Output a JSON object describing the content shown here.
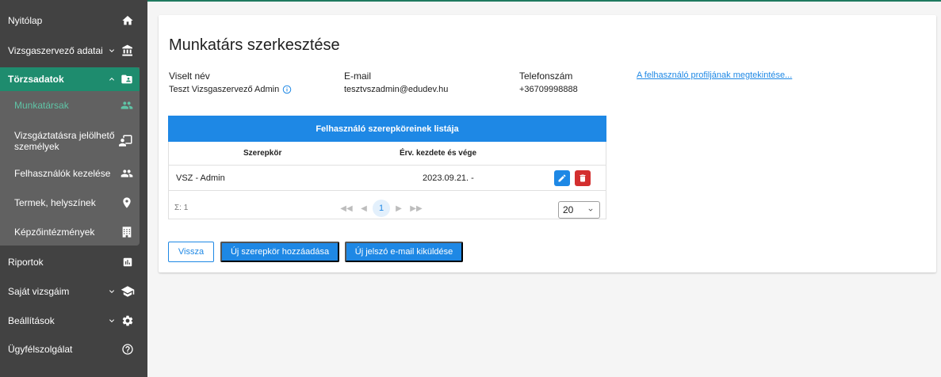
{
  "sidebar": {
    "items": [
      {
        "label": "Nyitólap"
      },
      {
        "label": "Vizsgaszervező adatai"
      },
      {
        "label": "Törzsadatok"
      },
      {
        "label": "Riportok"
      },
      {
        "label": "Saját vizsgáim"
      },
      {
        "label": "Beállítások"
      },
      {
        "label": "Ügyfélszolgálat"
      }
    ],
    "submenu": [
      {
        "label": "Munkatársak"
      },
      {
        "label": "Vizsgáztatásra jelölhető személyek"
      },
      {
        "label": "Felhasználók kezelése"
      },
      {
        "label": "Termek, helyszínek"
      },
      {
        "label": "Képzőintézmények"
      }
    ]
  },
  "page": {
    "title": "Munkatárs szerkesztése",
    "fields": {
      "name_label": "Viselt név",
      "name_value": "Teszt Vizsgaszervező Admin",
      "email_label": "E-mail",
      "email_value": "tesztvszadmin@edudev.hu",
      "phone_label": "Telefonszám",
      "phone_value": "+36709998888"
    },
    "profile_link": "A felhasználó profiljának megtekintése..."
  },
  "roles_table": {
    "title": "Felhasználó szerepköreinek listája",
    "columns": [
      "Szerepkör",
      "Érv. kezdete és vége"
    ],
    "rows": [
      {
        "role": "VSZ - Admin",
        "validity": "2023.09.21. -"
      }
    ],
    "sum_text": "Σ: 1",
    "current_page": "1",
    "page_size": "20"
  },
  "actions": {
    "back": "Vissza",
    "add_role": "Új szerepkör hozzáadása",
    "send_password": "Új jelszó e-mail kiküldése"
  },
  "colors": {
    "sidebar_bg": "#424242",
    "active_green": "#1e8c6e",
    "primary_blue": "#1e88e5",
    "delete_red": "#d32f2f"
  }
}
